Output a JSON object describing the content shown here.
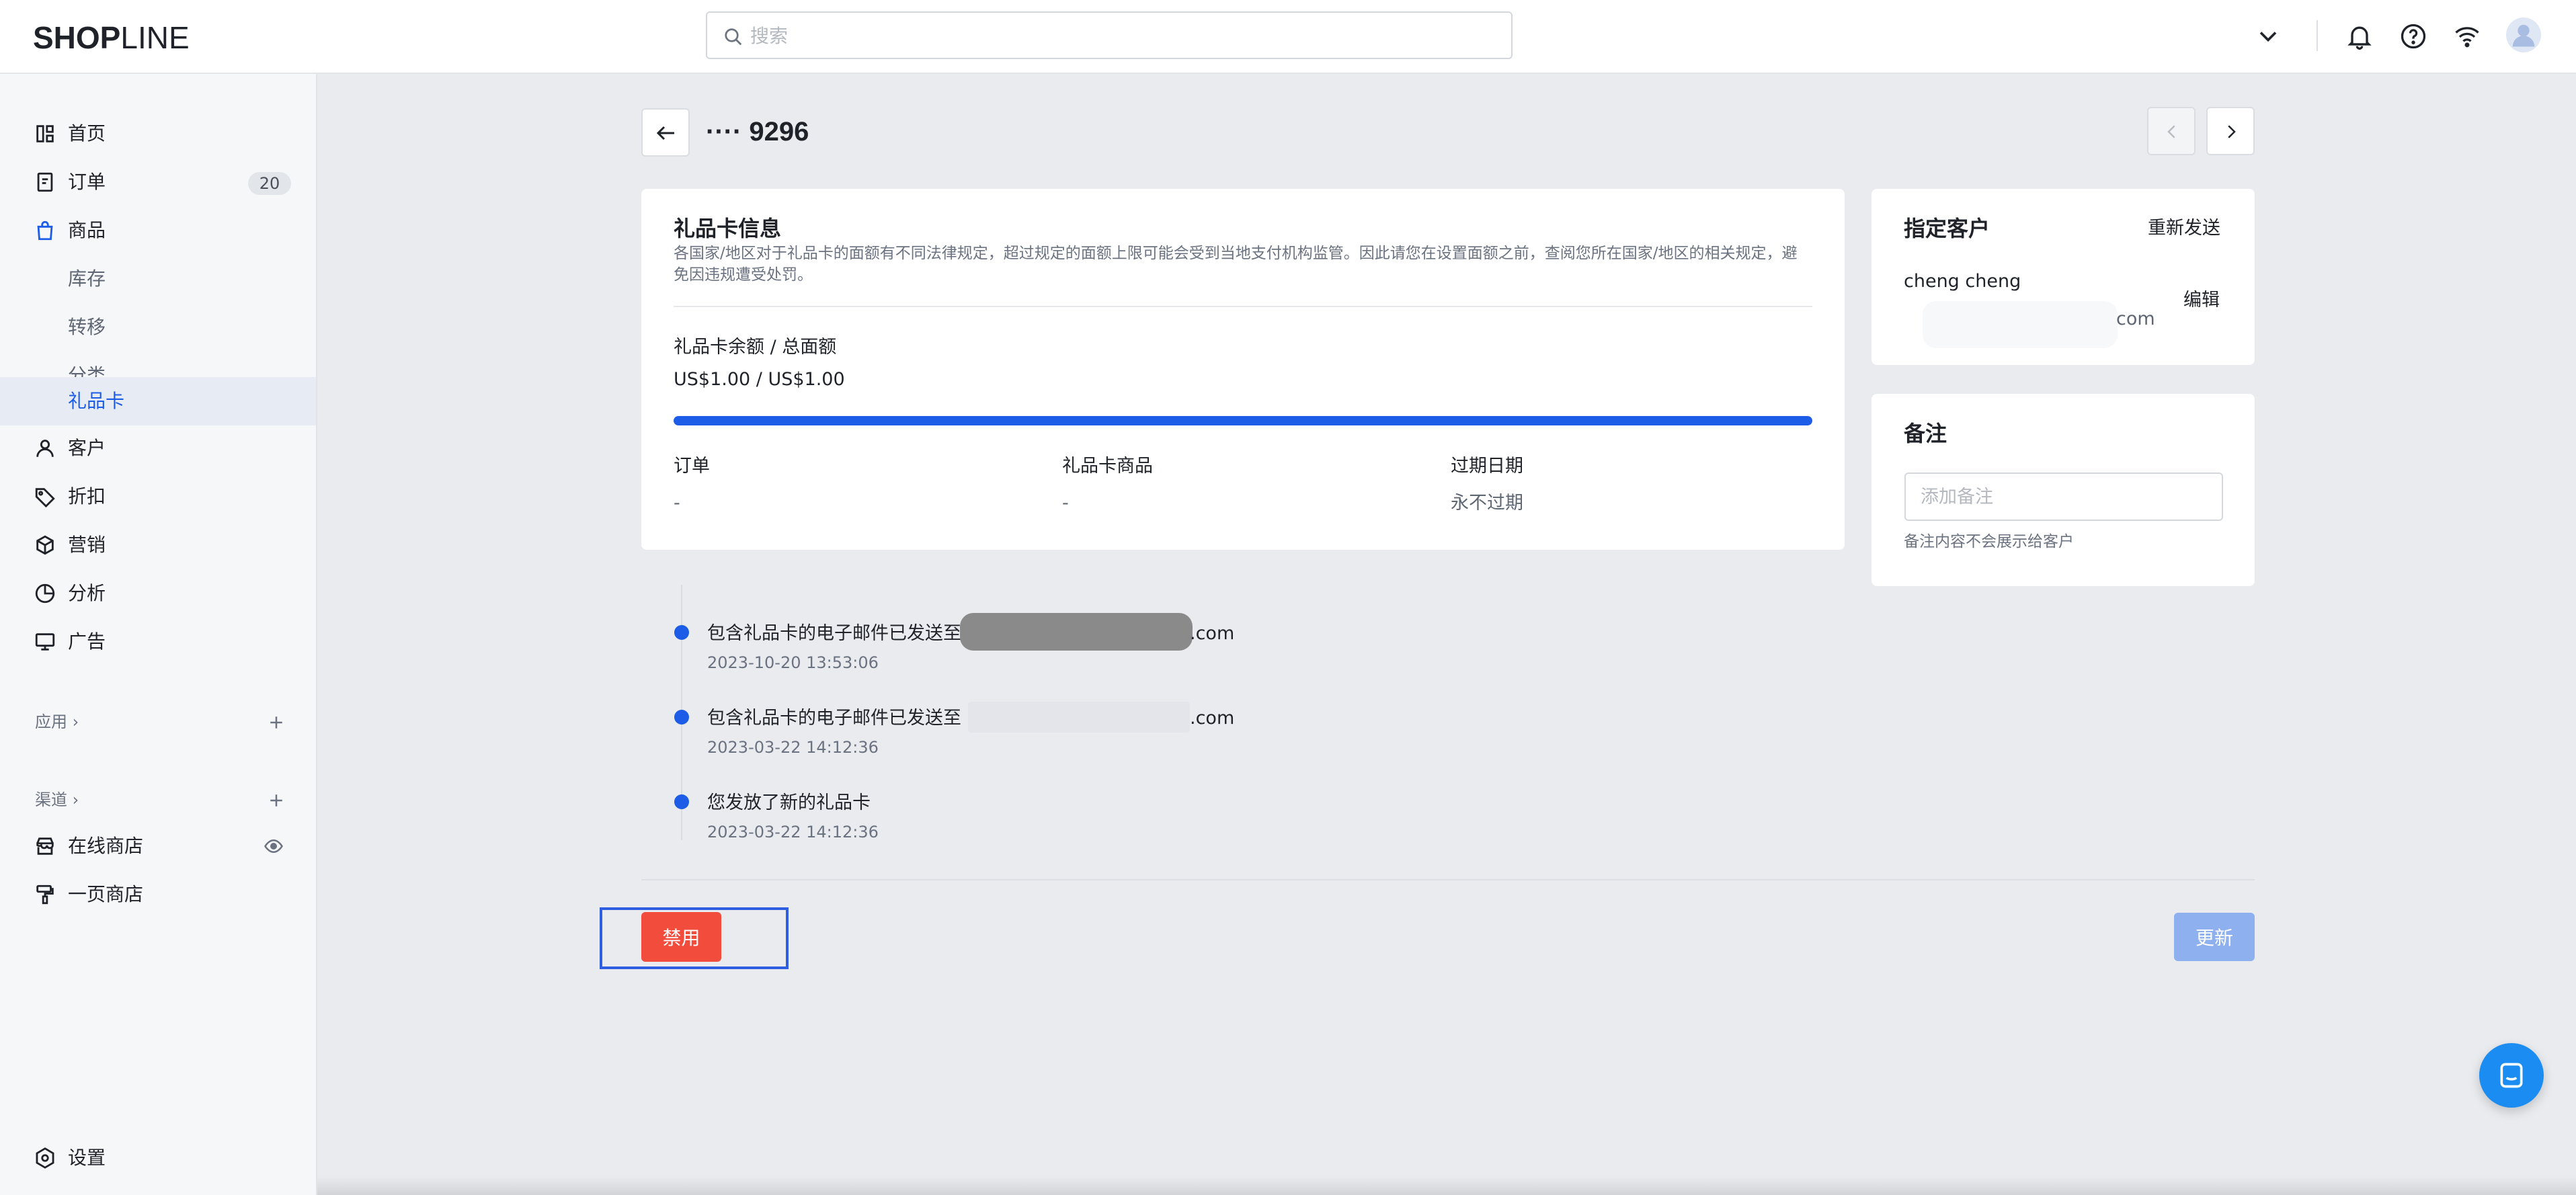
{
  "brand": {
    "logo_bold": "SHOP",
    "logo_thin": "LINE"
  },
  "search": {
    "placeholder": "搜索"
  },
  "sidebar": {
    "items": [
      {
        "label": "首页",
        "icon": "dashboard-icon"
      },
      {
        "label": "订单",
        "icon": "orders-icon",
        "badge": "20"
      },
      {
        "label": "商品",
        "icon": "shopping-bag-icon"
      },
      {
        "label": "库存"
      },
      {
        "label": "转移"
      },
      {
        "label": "分类"
      },
      {
        "label": "礼品卡"
      },
      {
        "label": "客户",
        "icon": "person-icon"
      },
      {
        "label": "折扣",
        "icon": "tag-icon"
      },
      {
        "label": "营销",
        "icon": "cube-icon"
      },
      {
        "label": "分析",
        "icon": "pie-chart-icon"
      },
      {
        "label": "广告",
        "icon": "ad-screen-icon"
      }
    ],
    "apps_label": "应用",
    "channels_label": "渠道",
    "channels": [
      {
        "label": "在线商店",
        "icon": "store-icon"
      },
      {
        "label": "一页商店",
        "icon": "paint-roller-icon"
      }
    ],
    "settings_label": "设置"
  },
  "page": {
    "title": "···· 9296"
  },
  "gift_card": {
    "title": "礼品卡信息",
    "description": "各国家/地区对于礼品卡的面额有不同法律规定，超过规定的面额上限可能会受到当地支付机构监管。因此请您在设置面额之前，查阅您所在国家/地区的相关规定，避免因违规遭受处罚。",
    "balance_label": "礼品卡余额 / 总面额",
    "balance_value": "US$1.00 / US$1.00",
    "balance_fraction": 1.0,
    "order_label": "订单",
    "order_value": "-",
    "product_label": "礼品卡商品",
    "product_value": "-",
    "expiry_label": "过期日期",
    "expiry_value": "永不过期"
  },
  "customer": {
    "title": "指定客户",
    "resend": "重新发送",
    "name": "cheng cheng",
    "email_suffix": "com",
    "edit": "编辑"
  },
  "note": {
    "title": "备注",
    "placeholder": "添加备注",
    "hint": "备注内容不会展示给客户"
  },
  "timeline": [
    {
      "text": "包含礼品卡的电子邮件已发送至",
      "suffix": ".com",
      "time": "2023-10-20 13:53:06"
    },
    {
      "text": "包含礼品卡的电子邮件已发送至",
      "suffix": ".com",
      "time": "2023-03-22 14:12:36"
    },
    {
      "text": "您发放了新的礼品卡",
      "suffix": "",
      "time": "2023-03-22 14:12:36"
    }
  ],
  "actions": {
    "disable": "禁用",
    "update": "更新"
  },
  "colors": {
    "accent": "#1c5ce6",
    "danger": "#f24c3d",
    "update_disabled": "#8fb0ee"
  }
}
